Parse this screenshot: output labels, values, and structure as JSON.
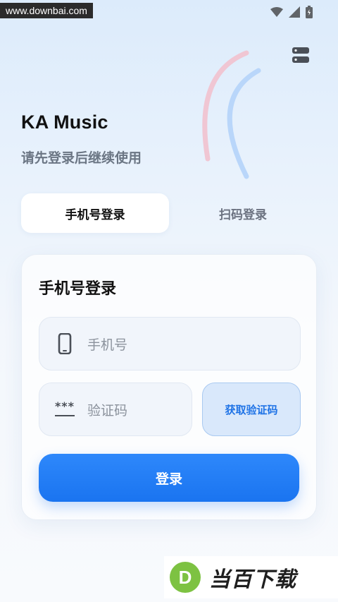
{
  "watermark_top": "www.downbai.com",
  "app": {
    "title": "KA Music",
    "subtitle": "请先登录后继续使用"
  },
  "tabs": [
    {
      "label": "手机号登录",
      "active": true
    },
    {
      "label": "扫码登录",
      "active": false
    }
  ],
  "card": {
    "title": "手机号登录",
    "phone_placeholder": "手机号",
    "code_placeholder": "验证码",
    "code_icon_text": "***",
    "get_code_label": "获取验证码",
    "login_label": "登录"
  },
  "brand_watermark": {
    "logo_letter": "D",
    "text": "当百下载"
  },
  "colors": {
    "accent": "#1a74f0",
    "arc_pink": "#f0c6d3",
    "arc_blue": "#b9d6fa",
    "brand_green": "#7dc242"
  },
  "icons": [
    "wifi-icon",
    "signal-icon",
    "battery-icon",
    "server-icon",
    "phone-icon"
  ]
}
